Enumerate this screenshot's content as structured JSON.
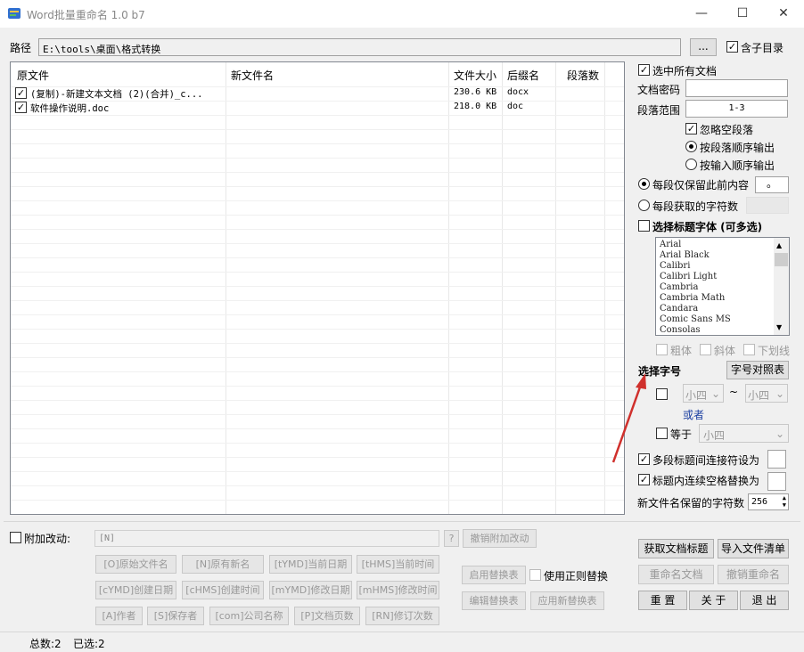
{
  "window": {
    "title": "Word批量重命名 1.0 b7",
    "minimize": "—",
    "maximize": "☐",
    "close": "✕"
  },
  "path": {
    "label": "路径",
    "value": "E:\\tools\\桌面\\格式转换",
    "browse": "...",
    "subdir_label": "含子目录"
  },
  "table": {
    "headers": [
      "原文件",
      "新文件名",
      "文件大小",
      "后缀名",
      "段落数"
    ],
    "rows": [
      {
        "original": "(复制)-新建文本文档 (2)(合并)_c...",
        "new_name": "",
        "size": "230.6 KB",
        "ext": "docx",
        "paragraphs": ""
      },
      {
        "original": "软件操作说明.doc",
        "new_name": "",
        "size": "218.0 KB",
        "ext": "doc",
        "paragraphs": ""
      }
    ]
  },
  "right": {
    "select_all": "选中所有文档",
    "doc_password": "文档密码",
    "para_range_label": "段落范围",
    "para_range_value": "1-3",
    "ignore_empty": "忽略空段落",
    "order_by_para": "按段落顺序输出",
    "order_by_input": "按输入顺序输出",
    "keep_before": "每段仅保留此前内容",
    "keep_before_value": "。",
    "char_count": "每段获取的字符数",
    "title_font": "选择标题字体 (可多选)",
    "fonts": [
      "Arial",
      "Arial Black",
      "Calibri",
      "Calibri Light",
      "Cambria",
      "Cambria Math",
      "Candara",
      "Comic Sans MS",
      "Consolas"
    ],
    "bold": "粗体",
    "italic": "斜体",
    "underline": "下划线",
    "font_size_label": "选择字号",
    "size_table_btn": "字号对照表",
    "size_from": "小四",
    "tilde": "~",
    "size_to": "小四",
    "or": "或者",
    "equals": "等于",
    "size_eq": "小四",
    "multi_connector": "多段标题间连接符设为",
    "space_replace": "标题内连续空格替换为",
    "keep_chars": "新文件名保留的字符数",
    "keep_chars_value": "256"
  },
  "bottom": {
    "append_label": "附加改动:",
    "append_value": "[N]",
    "question": "?",
    "undo_append": "撤销附加改动",
    "tags": [
      [
        "[O]原始文件名",
        "[N]原有新名",
        "[tYMD]当前日期",
        "[tHMS]当前时间"
      ],
      [
        "[cYMD]创建日期",
        "[cHMS]创建时间",
        "[mYMD]修改日期",
        "[mHMS]修改时间"
      ],
      [
        "[A]作者",
        "[S]保存者",
        "[com]公司名称",
        "[P]文档页数",
        "[RN]修订次数"
      ]
    ],
    "enable_replace": "启用替换表",
    "use_regex": "使用正则替换",
    "edit_replace": "编辑替换表",
    "apply_replace": "应用新替换表",
    "get_title": "获取文档标题",
    "import_list": "导入文件清单",
    "rename": "重命名文档",
    "undo_rename": "撤销重命名",
    "reset": "重 置",
    "about": "关 于",
    "exit": "退 出"
  },
  "status": {
    "total": "总数:2",
    "selected": "已选:2"
  },
  "colors": {
    "accent": "#1a3ea0",
    "arrow": "#d0302c"
  }
}
